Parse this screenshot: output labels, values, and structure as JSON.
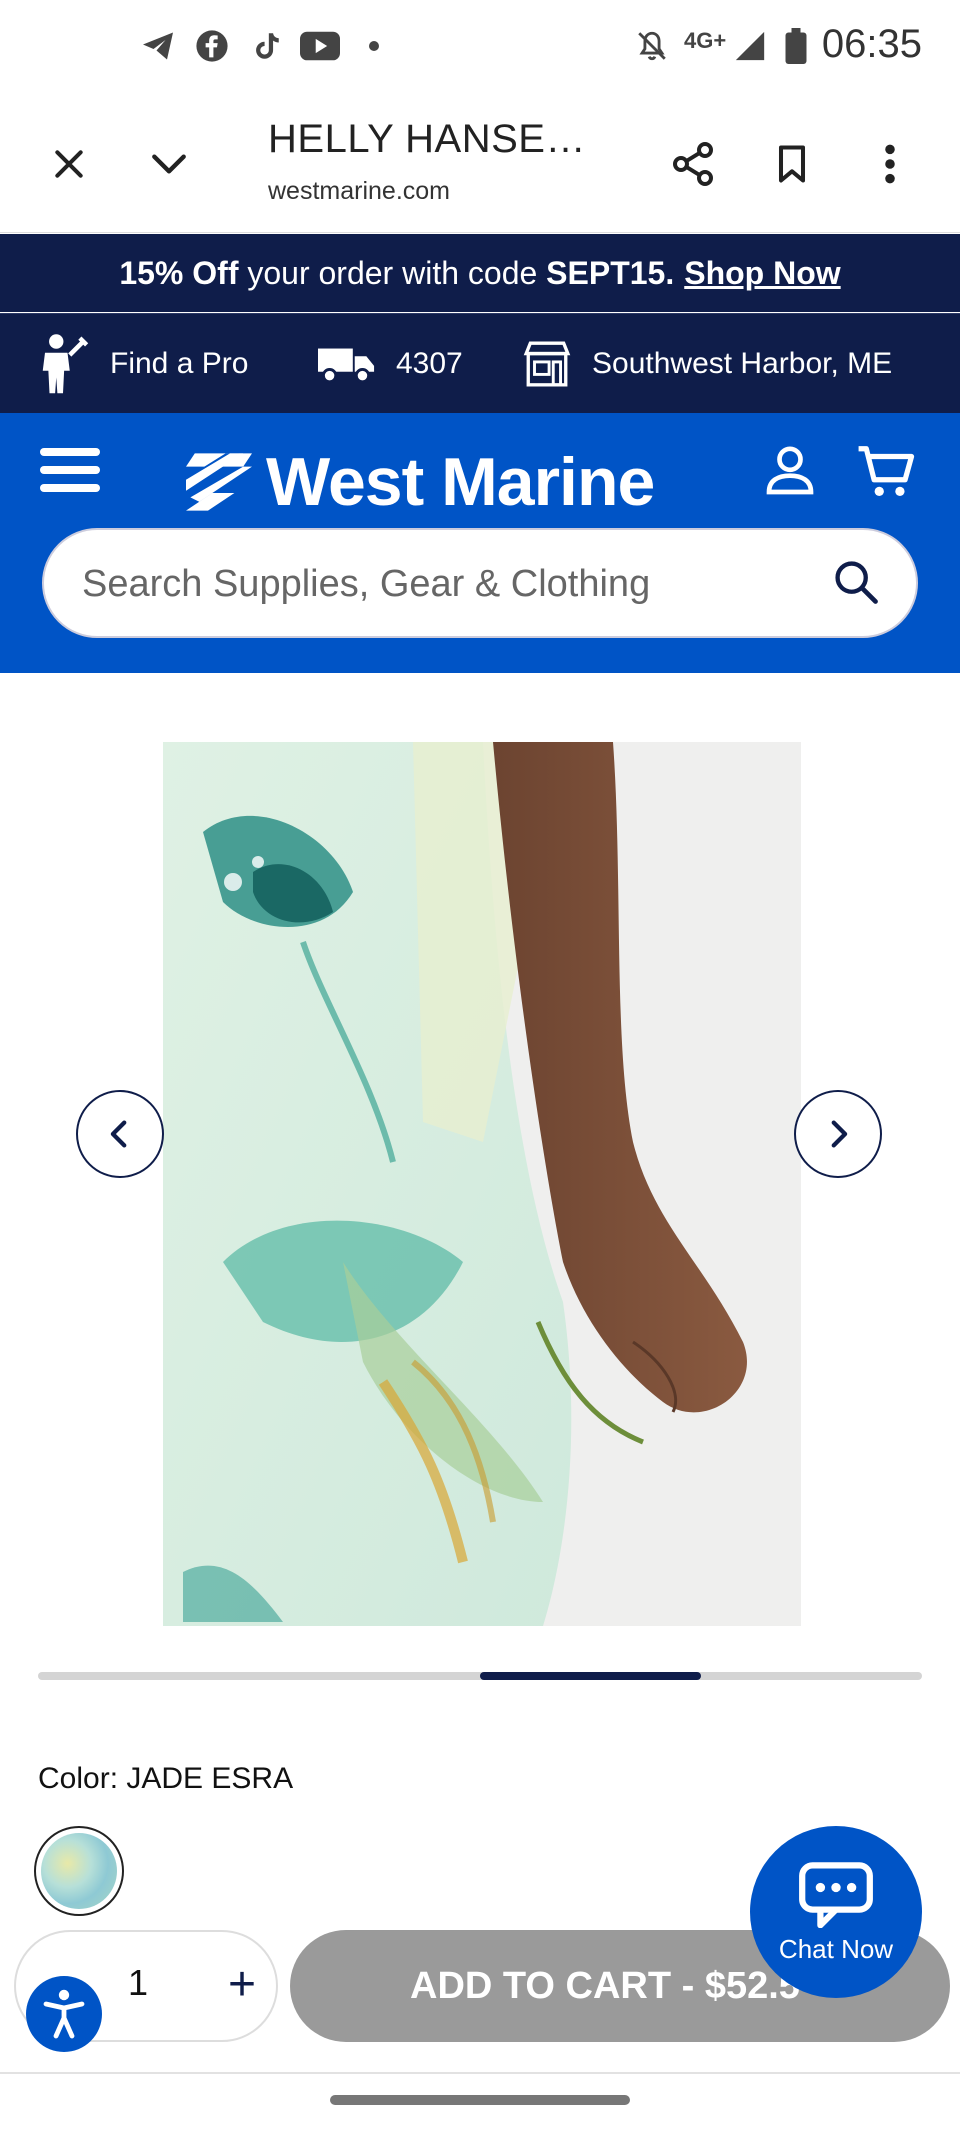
{
  "status_bar": {
    "time": "06:35",
    "network": "4G+",
    "left_icons": [
      "telegram-icon",
      "facebook-icon",
      "tiktok-icon",
      "youtube-icon",
      "dot-icon"
    ],
    "right_icons": [
      "mute-icon",
      "signal-icon",
      "battery-icon"
    ]
  },
  "browser": {
    "title": "HELLY HANSE…",
    "url": "westmarine.com",
    "icons": [
      "close-icon",
      "chevron-down-icon",
      "share-icon",
      "bookmark-icon",
      "more-vert-icon"
    ]
  },
  "promo": {
    "bold_lead": "15% Off",
    "text": " your order with code ",
    "code": "SEPT15.",
    "link": "Shop Now"
  },
  "utility": {
    "find_pro": "Find a Pro",
    "truck_count": "4307",
    "store": "Southwest Harbor, ME"
  },
  "header": {
    "logo_text": "West Marine",
    "search_placeholder": "Search Supplies, Gear & Clothing"
  },
  "gallery": {
    "progress_start": 0.5,
    "progress_end": 0.75
  },
  "product": {
    "color_label": "Color: JADE ESRA",
    "quantity": "1",
    "plus": "+",
    "add_to_cart": "ADD TO CART - $52.5"
  },
  "chat": {
    "label": "Chat Now"
  },
  "colors": {
    "navy": "#0f1d4a",
    "brand_blue": "#0054c6",
    "disabled_gray": "#9a9a9a"
  }
}
